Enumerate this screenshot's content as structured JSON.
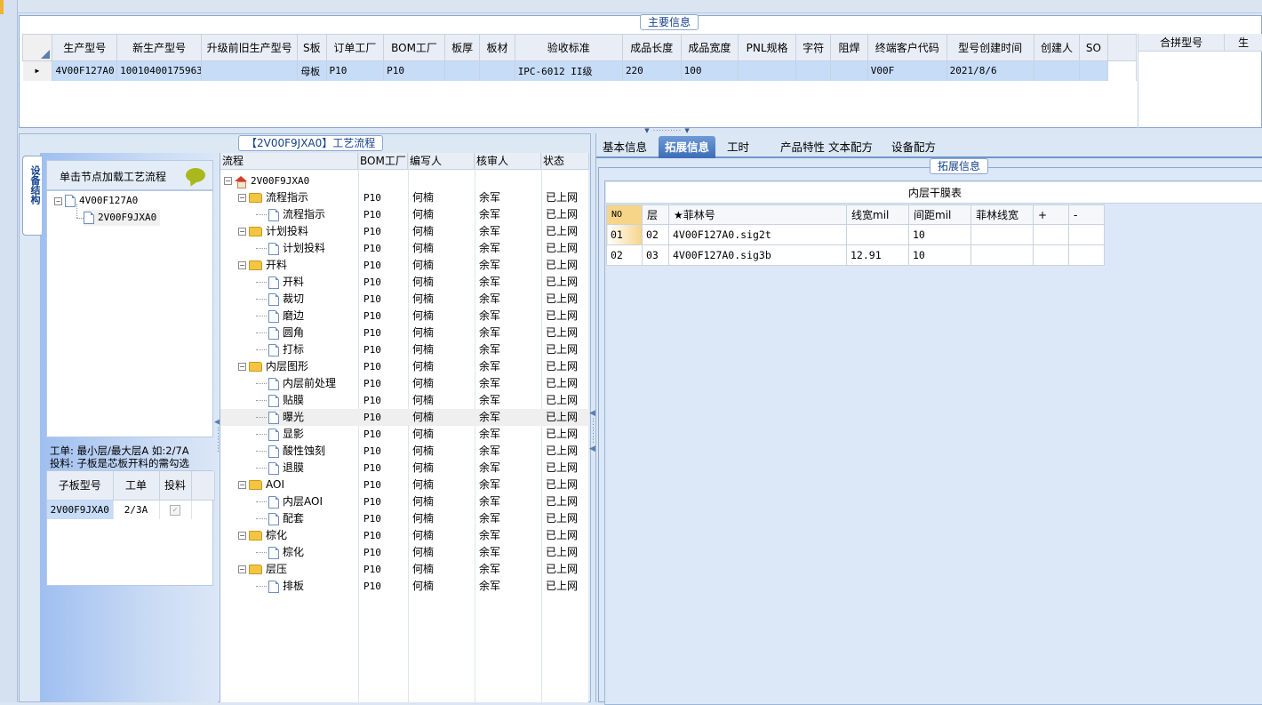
{
  "main": {
    "title": "主要信息",
    "columns": [
      "生产型号",
      "新生产型号",
      "升级前旧生产型号",
      "S板",
      "订单工厂",
      "BOM工厂",
      "板厚",
      "板材",
      "验收标准",
      "成品长度",
      "成品宽度",
      "PNL规格",
      "字符",
      "阻焊",
      "终端客户代码",
      "型号创建时间",
      "创建人",
      "SO"
    ],
    "row": [
      "4V00F127A0",
      "10010400175963",
      "",
      "母板",
      "P10",
      "P10",
      "",
      "",
      "IPC-6012 II级",
      "220",
      "100",
      "",
      "",
      "",
      "V00F",
      "2021/8/6",
      "",
      ""
    ],
    "merge_columns": [
      "合拼型号",
      "生"
    ]
  },
  "left": {
    "vtab": "设备结构",
    "load_hint": "单击节点加载工艺流程",
    "tree": [
      "4V00F127A0",
      "2V00F9JXA0"
    ],
    "note1": "工单: 最小层/最大层A 如:2/7A",
    "note2": "投料: 子板是芯板开料的需勾选",
    "sub_columns": [
      "子板型号",
      "工单",
      "投料"
    ],
    "sub_row": [
      "2V00F9JXA0",
      "2/3A",
      "✓"
    ]
  },
  "process": {
    "title": "【2V00F9JXA0】工艺流程",
    "columns": [
      "流程",
      "BOM工厂",
      "编写人",
      "核审人",
      "状态"
    ],
    "root": "2V00F9JXA0",
    "rows": [
      {
        "name": "流程指示",
        "folder": true,
        "bom": "P10",
        "writer": "何楠",
        "reviewer": "余军",
        "status": "已上网"
      },
      {
        "name": "流程指示",
        "folder": false,
        "bom": "P10",
        "writer": "何楠",
        "reviewer": "余军",
        "status": "已上网"
      },
      {
        "name": "计划投料",
        "folder": true,
        "bom": "P10",
        "writer": "何楠",
        "reviewer": "余军",
        "status": "已上网"
      },
      {
        "name": "计划投料",
        "folder": false,
        "bom": "P10",
        "writer": "何楠",
        "reviewer": "余军",
        "status": "已上网"
      },
      {
        "name": "开料",
        "folder": true,
        "bom": "P10",
        "writer": "何楠",
        "reviewer": "余军",
        "status": "已上网"
      },
      {
        "name": "开料",
        "folder": false,
        "bom": "P10",
        "writer": "何楠",
        "reviewer": "余军",
        "status": "已上网"
      },
      {
        "name": "裁切",
        "folder": false,
        "bom": "P10",
        "writer": "何楠",
        "reviewer": "余军",
        "status": "已上网"
      },
      {
        "name": "磨边",
        "folder": false,
        "bom": "P10",
        "writer": "何楠",
        "reviewer": "余军",
        "status": "已上网"
      },
      {
        "name": "圆角",
        "folder": false,
        "bom": "P10",
        "writer": "何楠",
        "reviewer": "余军",
        "status": "已上网"
      },
      {
        "name": "打标",
        "folder": false,
        "bom": "P10",
        "writer": "何楠",
        "reviewer": "余军",
        "status": "已上网"
      },
      {
        "name": "内层图形",
        "folder": true,
        "bom": "P10",
        "writer": "何楠",
        "reviewer": "余军",
        "status": "已上网"
      },
      {
        "name": "内层前处理",
        "folder": false,
        "bom": "P10",
        "writer": "何楠",
        "reviewer": "余军",
        "status": "已上网"
      },
      {
        "name": "贴膜",
        "folder": false,
        "bom": "P10",
        "writer": "何楠",
        "reviewer": "余军",
        "status": "已上网"
      },
      {
        "name": "曝光",
        "folder": false,
        "bom": "P10",
        "writer": "何楠",
        "reviewer": "余军",
        "status": "已上网",
        "highlight": true
      },
      {
        "name": "显影",
        "folder": false,
        "bom": "P10",
        "writer": "何楠",
        "reviewer": "余军",
        "status": "已上网"
      },
      {
        "name": "酸性蚀刻",
        "folder": false,
        "bom": "P10",
        "writer": "何楠",
        "reviewer": "余军",
        "status": "已上网"
      },
      {
        "name": "退膜",
        "folder": false,
        "bom": "P10",
        "writer": "何楠",
        "reviewer": "余军",
        "status": "已上网"
      },
      {
        "name": "AOI",
        "folder": true,
        "bom": "P10",
        "writer": "何楠",
        "reviewer": "余军",
        "status": "已上网"
      },
      {
        "name": "内层AOI",
        "folder": false,
        "bom": "P10",
        "writer": "何楠",
        "reviewer": "余军",
        "status": "已上网"
      },
      {
        "name": "配套",
        "folder": false,
        "bom": "P10",
        "writer": "何楠",
        "reviewer": "余军",
        "status": "已上网"
      },
      {
        "name": "棕化",
        "folder": true,
        "bom": "P10",
        "writer": "何楠",
        "reviewer": "余军",
        "status": "已上网"
      },
      {
        "name": "棕化",
        "folder": false,
        "bom": "P10",
        "writer": "何楠",
        "reviewer": "余军",
        "status": "已上网"
      },
      {
        "name": "层压",
        "folder": true,
        "bom": "P10",
        "writer": "何楠",
        "reviewer": "余军",
        "status": "已上网"
      },
      {
        "name": "排板",
        "folder": false,
        "bom": "P10",
        "writer": "何楠",
        "reviewer": "余军",
        "status": "已上网"
      }
    ]
  },
  "right": {
    "tabs": [
      "基本信息",
      "拓展信息",
      "工时",
      "产品特性",
      "文本配方",
      "设备配方"
    ],
    "active_tab": 1,
    "group_title": "拓展信息",
    "film_title": "内层干膜表",
    "film_columns": [
      "NO",
      "层",
      "★菲林号",
      "线宽mil",
      "间距mil",
      "菲林线宽",
      "+",
      "-"
    ],
    "film_rows": [
      [
        "01",
        "02",
        "4V00F127A0.sig2t",
        "",
        "10",
        "",
        "",
        ""
      ],
      [
        "02",
        "03",
        "4V00F127A0.sig3b",
        "12.91",
        "10",
        "",
        "",
        ""
      ]
    ]
  },
  "icons": {
    "expander": "minus-box-icon",
    "leaf": "document-icon",
    "folder": "folder-icon",
    "root": "home-icon",
    "hint": "speech-bubble-icon"
  }
}
